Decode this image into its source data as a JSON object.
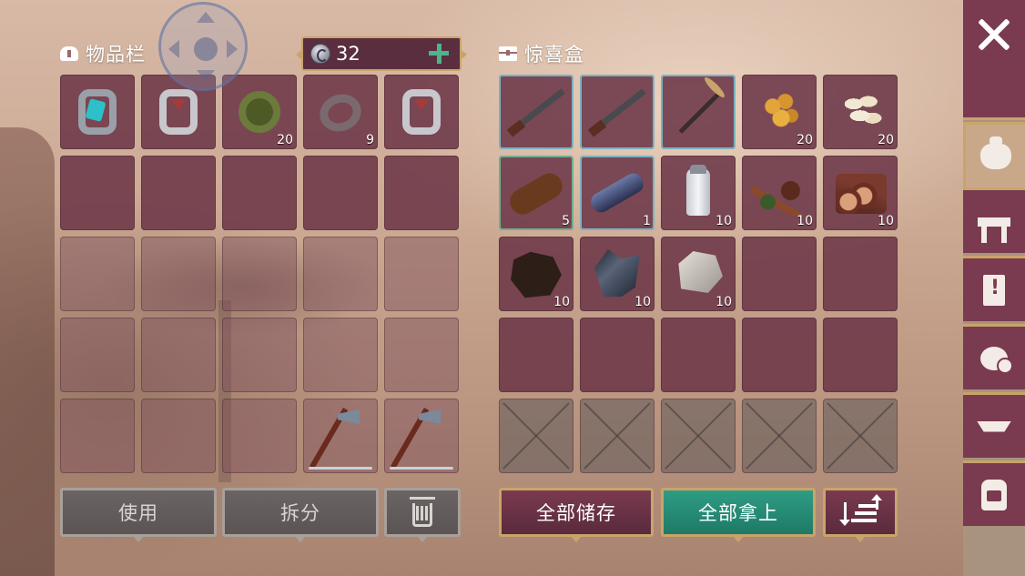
{
  "inventory": {
    "title": "物品栏",
    "slots": [
      {
        "item": "teal-gem-ring-icon",
        "count": ""
      },
      {
        "item": "red-gem-ring-icon",
        "count": ""
      },
      {
        "item": "green-ring-icon",
        "count": "20"
      },
      {
        "item": "iron-ring-icon",
        "count": "9"
      },
      {
        "item": "red-gem-ring-icon",
        "count": ""
      },
      {
        "item": "",
        "count": ""
      },
      {
        "item": "",
        "count": ""
      },
      {
        "item": "",
        "count": ""
      },
      {
        "item": "",
        "count": ""
      },
      {
        "item": "",
        "count": ""
      },
      {
        "item": "",
        "count": ""
      },
      {
        "item": "",
        "count": ""
      },
      {
        "item": "",
        "count": ""
      },
      {
        "item": "",
        "count": ""
      },
      {
        "item": "",
        "count": ""
      },
      {
        "item": "",
        "count": ""
      },
      {
        "item": "",
        "count": ""
      },
      {
        "item": "",
        "count": ""
      },
      {
        "item": "",
        "count": ""
      },
      {
        "item": "",
        "count": ""
      },
      {
        "item": "",
        "count": ""
      },
      {
        "item": "",
        "count": ""
      },
      {
        "item": "",
        "count": ""
      },
      {
        "item": "hatchet-icon",
        "count": "",
        "durability": 1.0
      },
      {
        "item": "hatchet-icon",
        "count": "",
        "durability": 1.0
      }
    ],
    "buttons": {
      "use": "使用",
      "split": "拆分",
      "delete_icon": "trash-icon"
    }
  },
  "currency": {
    "icon": "coin-icon",
    "value": "32",
    "add_icon": "plus-icon",
    "add_color": "#4fb38c"
  },
  "surprise_box": {
    "title": "惊喜盒",
    "slots": [
      {
        "item": "shotgun-icon",
        "count": "",
        "rarity": "blue"
      },
      {
        "item": "axe-rifle-icon",
        "count": "",
        "rarity": "blue"
      },
      {
        "item": "pickaxe-rifle-icon",
        "count": "",
        "rarity": "blue"
      },
      {
        "item": "grain-seeds-icon",
        "count": "20"
      },
      {
        "item": "white-seeds-icon",
        "count": "20"
      },
      {
        "item": "leather-roll-icon",
        "count": "5",
        "rarity": "green"
      },
      {
        "item": "metal-tube-icon",
        "count": "1",
        "rarity": "blue"
      },
      {
        "item": "salt-shaker-icon",
        "count": "10"
      },
      {
        "item": "spices-icon",
        "count": "10"
      },
      {
        "item": "logs-icon",
        "count": "10"
      },
      {
        "item": "animal-hide-icon",
        "count": "10"
      },
      {
        "item": "dark-crystal-icon",
        "count": "10"
      },
      {
        "item": "stone-icon",
        "count": "10"
      },
      {
        "item": "",
        "count": ""
      },
      {
        "item": "",
        "count": ""
      },
      {
        "item": "",
        "count": ""
      },
      {
        "item": "",
        "count": ""
      },
      {
        "item": "",
        "count": ""
      },
      {
        "item": "",
        "count": ""
      },
      {
        "item": "",
        "count": ""
      },
      {
        "item": "locked",
        "count": ""
      },
      {
        "item": "locked",
        "count": ""
      },
      {
        "item": "locked",
        "count": ""
      },
      {
        "item": "locked",
        "count": ""
      },
      {
        "item": "locked",
        "count": ""
      }
    ],
    "buttons": {
      "store_all": "全部储存",
      "take_all": "全部拿上",
      "sort_icon": "sort-icon"
    }
  },
  "sidebar": {
    "close_icon": "close-icon",
    "tabs": [
      {
        "icon": "sack-icon",
        "active": true
      },
      {
        "icon": "workbench-icon",
        "active": false
      },
      {
        "icon": "quest-note-icon",
        "active": false
      },
      {
        "icon": "coin-bags-icon",
        "active": false
      },
      {
        "icon": "anvil-icon",
        "active": false
      },
      {
        "icon": "backpack-icon",
        "active": false
      }
    ]
  },
  "colors": {
    "slot": "#6c3748",
    "accent_gold": "#c9a46a",
    "take_button": "#2f9c84",
    "store_button": "#7a3a50"
  }
}
